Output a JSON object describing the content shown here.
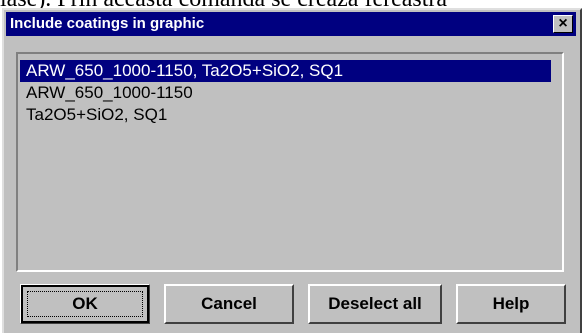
{
  "background_text": "lase). Prin aceasta comanda se creaza fereastra",
  "dialog": {
    "title": "Include coatings in graphic",
    "close_label": "×"
  },
  "list": {
    "items": [
      {
        "label": "ARW_650_1000-1150, Ta2O5+SiO2, SQ1",
        "selected": true
      },
      {
        "label": "ARW_650_1000-1150",
        "selected": false
      },
      {
        "label": "Ta2O5+SiO2, SQ1",
        "selected": false
      }
    ]
  },
  "buttons": {
    "ok": "OK",
    "cancel": "Cancel",
    "deselect_all": "Deselect all",
    "help": "Help"
  },
  "colors": {
    "titlebar": "#000080",
    "selection": "#000080",
    "face": "#c0c0c0"
  }
}
